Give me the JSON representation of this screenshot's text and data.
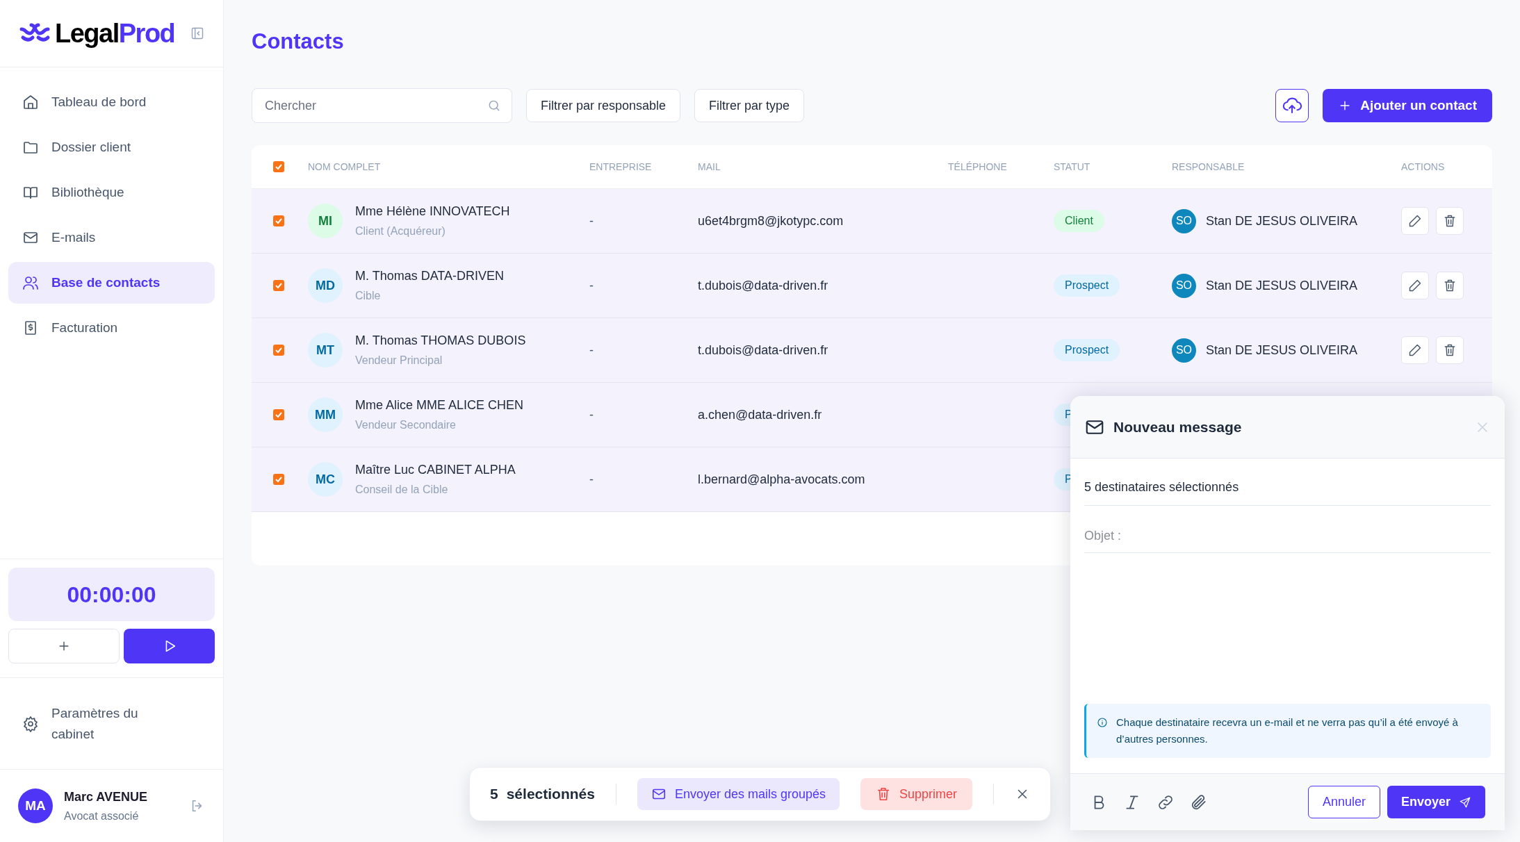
{
  "sidebar": {
    "logo": {
      "text_dark": "Legal",
      "text_accent": "Prod"
    },
    "items": [
      {
        "label": "Tableau de bord",
        "selected": false
      },
      {
        "label": "Dossier client",
        "selected": false
      },
      {
        "label": "Bibliothèque",
        "selected": false
      },
      {
        "label": "E-mails",
        "selected": false
      },
      {
        "label": "Base de contacts",
        "selected": true
      },
      {
        "label": "Facturation",
        "selected": false
      }
    ],
    "timer": "00:00:00",
    "settings": "Paramètres du cabinet",
    "user": {
      "initials": "MA",
      "name": "Marc AVENUE",
      "role": "Avocat associé"
    }
  },
  "page": {
    "title": "Contacts",
    "search": {
      "placeholder": "Chercher"
    },
    "filters": [
      "Filtrer par responsable",
      "Filtrer par type"
    ],
    "add_button": "Ajouter un contact"
  },
  "table": {
    "select_all_checked": true,
    "columns": [
      "NOM COMPLET",
      "ENTREPRISE",
      "MAIL",
      "TÉLÉPHONE",
      "STATUT",
      "RESPONSABLE",
      "ACTIONS"
    ],
    "rows": [
      {
        "selected": true,
        "initials": "MI",
        "name": "Mme Hélène INNOVATECH",
        "role": "Client (Acquéreur)",
        "company": "-",
        "mail": "u6et4brgm8@jkotypc.com",
        "status": {
          "text": "Client",
          "kind": "client"
        },
        "owner": {
          "initials": "SO",
          "name": "Stan DE JESUS OLIVEIRA"
        }
      },
      {
        "selected": true,
        "initials": "MD",
        "name": "M. Thomas DATA-DRIVEN",
        "role": "Cible",
        "company": "-",
        "mail": "t.dubois@data-driven.fr",
        "status": {
          "text": "Prospect",
          "kind": "prospect"
        },
        "owner": {
          "initials": "SO",
          "name": "Stan DE JESUS OLIVEIRA"
        }
      },
      {
        "selected": true,
        "initials": "MT",
        "name": "M. Thomas THOMAS DUBOIS",
        "role": "Vendeur Principal",
        "company": "-",
        "mail": "t.dubois@data-driven.fr",
        "status": {
          "text": "Prospect",
          "kind": "prospect"
        },
        "owner": {
          "initials": "SO",
          "name": "Stan DE JESUS OLIVEIRA"
        }
      },
      {
        "selected": true,
        "initials": "MM",
        "name": "Mme Alice MME ALICE CHEN",
        "role": "Vendeur Secondaire",
        "company": "-",
        "mail": "a.chen@data-driven.fr",
        "status": {
          "text": "P",
          "kind": "prospect"
        }
      },
      {
        "selected": true,
        "initials": "MC",
        "name": "Maître Luc CABINET ALPHA",
        "role": "Conseil de la Cible",
        "company": "-",
        "mail": "l.bernard@alpha-avocats.com",
        "status": {
          "text": "P",
          "kind": "prospect"
        }
      }
    ]
  },
  "selection_bar": {
    "count": "5",
    "label": "sélectionnés",
    "mail_button": "Envoyer des mails groupés",
    "delete_button": "Supprimer"
  },
  "compose": {
    "title": "Nouveau message",
    "recipients": "5 destinataires sélectionnés",
    "subject": {
      "placeholder": "Objet :"
    },
    "info": "Chaque destinataire recevra un e-mail et ne verra pas qu’il a été envoyé à d’autres personnes.",
    "cancel": "Annuler",
    "send": "Envoyer"
  }
}
